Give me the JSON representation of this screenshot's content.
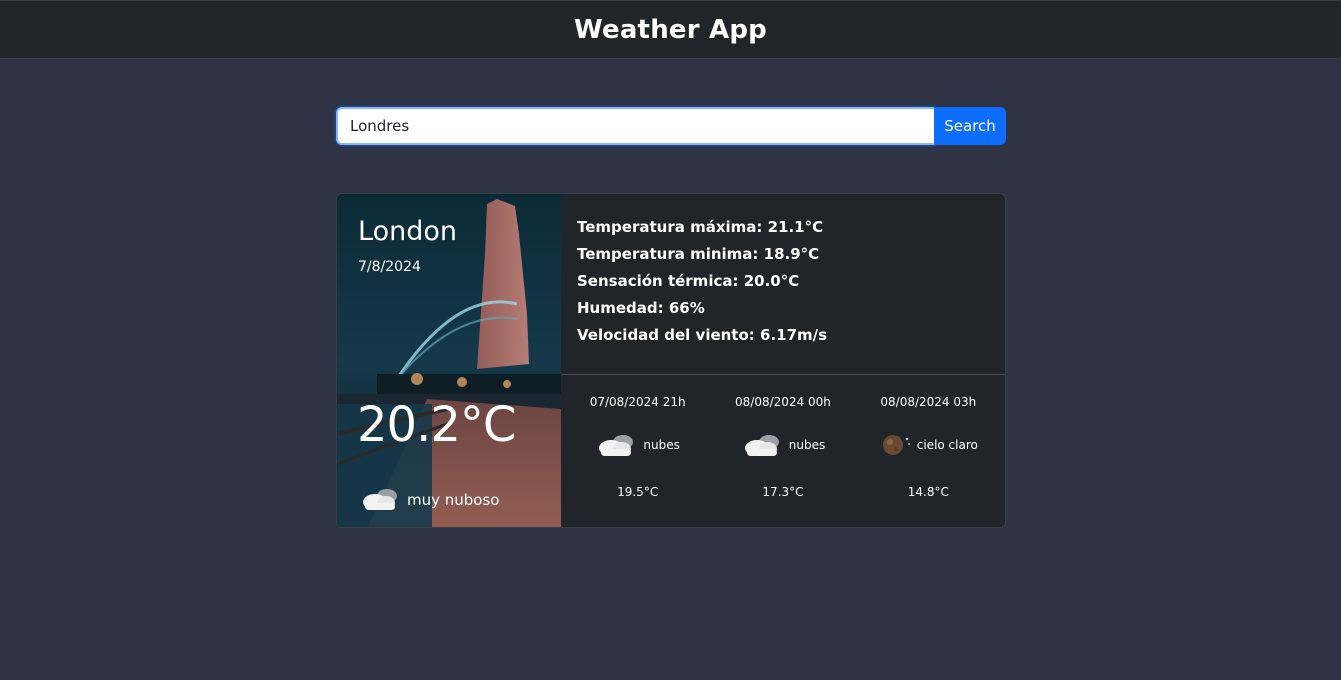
{
  "header": {
    "title": "Weather App"
  },
  "search": {
    "value": "Londres",
    "button_label": "Search"
  },
  "current": {
    "city": "London",
    "date": "7/8/2024",
    "temperature": "20.2°C",
    "condition": "muy nuboso",
    "condition_icon": "clouds-icon"
  },
  "stats": {
    "max_temp": "Temperatura máxima: 21.1°C",
    "min_temp": "Temperatura minima: 18.9°C",
    "feels_like": "Sensación térmica: 20.0°C",
    "humidity": "Humedad: 66%",
    "wind_speed": "Velocidad del viento: 6.17m/s"
  },
  "forecast": [
    {
      "time": "07/08/2024 21h",
      "icon": "clouds-icon",
      "description": "nubes",
      "temperature": "19.5°C"
    },
    {
      "time": "08/08/2024 00h",
      "icon": "clouds-icon",
      "description": "nubes",
      "temperature": "17.3°C"
    },
    {
      "time": "08/08/2024 03h",
      "icon": "moon-clear-icon",
      "description": "cielo claro",
      "temperature": "14.8°C"
    }
  ]
}
